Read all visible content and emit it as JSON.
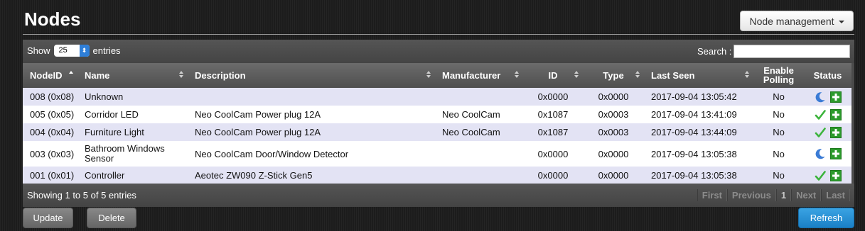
{
  "page": {
    "title": "Nodes"
  },
  "header": {
    "menu_button": "Node management"
  },
  "table_controls": {
    "show_label": "Show",
    "page_size": "25",
    "entries_label": "entries",
    "search_label": "Search :",
    "search_value": ""
  },
  "columns": [
    "NodeID",
    "Name",
    "Description",
    "Manufacturer",
    "ID",
    "Type",
    "Last Seen",
    "Enable Polling",
    "Status"
  ],
  "rows": [
    {
      "nodeid": "008 (0x08)",
      "name": "Unknown",
      "description": "",
      "manufacturer": "",
      "id": "0x0000",
      "type": "0x0000",
      "last_seen": "2017-09-04 13:05:42",
      "polling": "No",
      "status": "sleeping",
      "status_icon": "moon-icon"
    },
    {
      "nodeid": "005 (0x05)",
      "name": "Corridor LED",
      "description": "Neo CoolCam Power plug 12A",
      "manufacturer": "Neo CoolCam",
      "id": "0x1087",
      "type": "0x0003",
      "last_seen": "2017-09-04 13:41:09",
      "polling": "No",
      "status": "ok",
      "status_icon": "check-icon"
    },
    {
      "nodeid": "004 (0x04)",
      "name": "Furniture Light",
      "description": "Neo CoolCam Power plug 12A",
      "manufacturer": "Neo CoolCam",
      "id": "0x1087",
      "type": "0x0003",
      "last_seen": "2017-09-04 13:44:09",
      "polling": "No",
      "status": "ok",
      "status_icon": "check-icon"
    },
    {
      "nodeid": "003 (0x03)",
      "name": "Bathroom Windows Sensor",
      "description": "Neo CoolCam Door/Window Detector",
      "manufacturer": "",
      "id": "0x0000",
      "type": "0x0000",
      "last_seen": "2017-09-04 13:05:38",
      "polling": "No",
      "status": "sleeping",
      "status_icon": "moon-icon"
    },
    {
      "nodeid": "001 (0x01)",
      "name": "Controller",
      "description": "Aeotec ZW090 Z-Stick Gen5",
      "manufacturer": "",
      "id": "0x0000",
      "type": "0x0000",
      "last_seen": "2017-09-04 13:05:38",
      "polling": "No",
      "status": "ok",
      "status_icon": "check-icon"
    }
  ],
  "footer": {
    "info": "Showing 1 to 5 of 5 entries",
    "pagination": [
      "First",
      "Previous",
      "1",
      "Next",
      "Last"
    ]
  },
  "buttons": {
    "update": "Update",
    "delete": "Delete",
    "refresh": "Refresh"
  },
  "colors": {
    "row_odd": "#e3e3f4",
    "row_even": "#ffffff",
    "refresh": "#1a80c6",
    "check": "#3cb43c",
    "add": "#2b9a2b",
    "moon": "#3a7bd5"
  }
}
